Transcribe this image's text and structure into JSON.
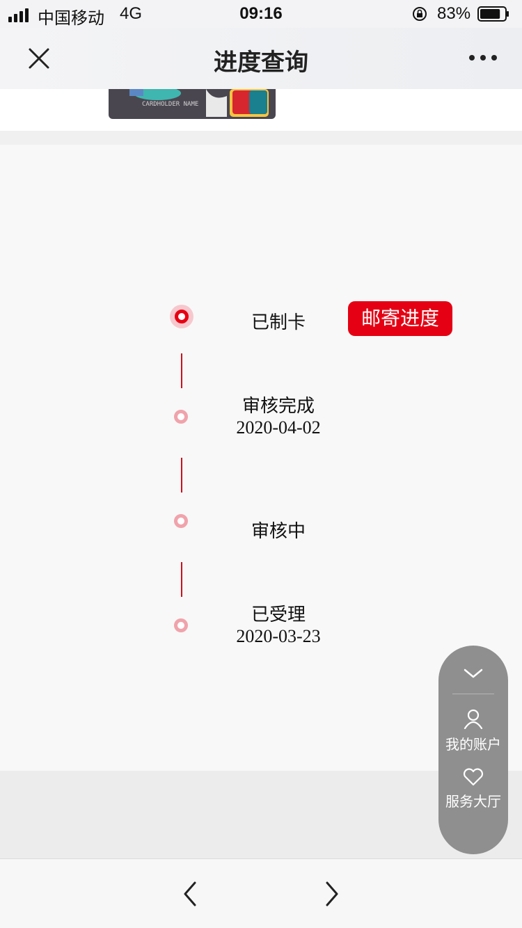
{
  "status_bar": {
    "carrier": "中国移动",
    "network": "4G",
    "time": "09:16",
    "battery_percent": "83%",
    "battery_level": 0.83
  },
  "nav": {
    "title": "进度查询",
    "close_icon": "close-icon",
    "more_icon": "more-icon"
  },
  "card": {
    "image_icon": "credit-card-image",
    "brand": "UnionPay 银联"
  },
  "progress": {
    "steps": [
      {
        "label": "已制卡",
        "date": "",
        "active": true
      },
      {
        "label": "审核完成",
        "date": "2020-04-02",
        "active": false
      },
      {
        "label": "审核中",
        "date": "",
        "active": false
      },
      {
        "label": "已受理",
        "date": "2020-03-23",
        "active": false
      }
    ],
    "mail_button": "邮寄进度"
  },
  "float_panel": {
    "collapse_icon": "chevron-down-icon",
    "account": "我的账户",
    "service": "服务大厅"
  },
  "bottom_nav": {
    "back_icon": "chevron-left-icon",
    "forward_icon": "chevron-right-icon"
  },
  "colors": {
    "accent": "#e50013",
    "timeline_line": "#c8101e",
    "dot_ring": "#f0a3ab",
    "float_panel": "#8f8f8f"
  }
}
